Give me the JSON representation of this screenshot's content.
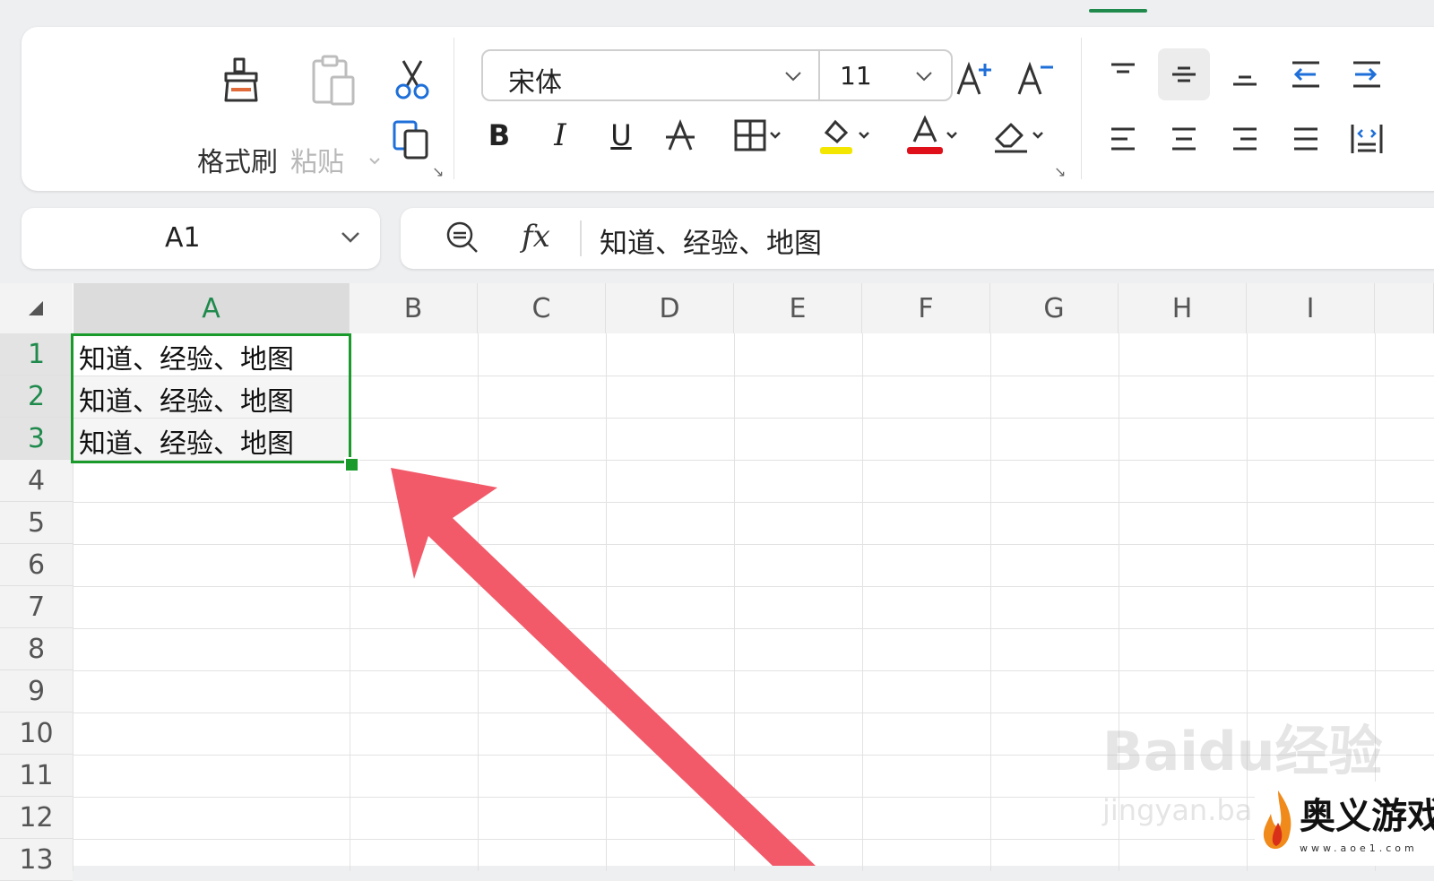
{
  "ribbon": {
    "format_painter_label": "格式刷",
    "paste_label": "粘贴",
    "font_name": "宋体",
    "font_size": "11",
    "bold": "B",
    "italic": "I",
    "underline": "U"
  },
  "name_box": {
    "value": "A1"
  },
  "formula_bar": {
    "fx_label": "fx",
    "value": "知道、经验、地图"
  },
  "sheet": {
    "columns": [
      "A",
      "B",
      "C",
      "D",
      "E",
      "F",
      "G",
      "H",
      "I"
    ],
    "rows": [
      "1",
      "2",
      "3",
      "4",
      "5",
      "6",
      "7",
      "8",
      "9",
      "10",
      "11",
      "12",
      "13"
    ],
    "cells": {
      "A1": "知道、经验、地图",
      "A2": "知道、经验、地图",
      "A3": "知道、经验、地图"
    },
    "selected_range": "A1:A3"
  },
  "colors": {
    "accent_green": "#1a9a2a",
    "annotation_arrow": "#f25a6a",
    "highlight_yellow": "#f3e600",
    "font_red": "#e0101a"
  },
  "watermark": {
    "brand": "Baidu经验",
    "domain": "jingyan.baidu.com",
    "logo_text": "奥义游戏网",
    "logo_url": "www.aoe1.com"
  }
}
